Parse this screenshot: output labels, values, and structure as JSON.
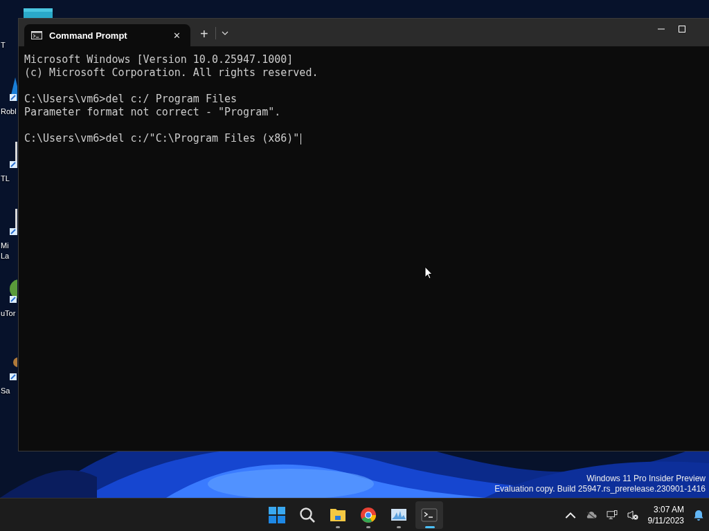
{
  "desktop": {
    "icons": [
      {
        "kind": "folder",
        "label": "T"
      },
      {
        "kind": "app",
        "label": "Robl"
      },
      {
        "kind": "doc",
        "label": "TL"
      },
      {
        "kind": "doc",
        "label": "Mi La"
      },
      {
        "kind": "torrent",
        "label": "uTor"
      },
      {
        "kind": "person",
        "label": "Sa"
      }
    ],
    "edition": [
      "Windows 11 Pro Insider Preview",
      "Evaluation copy. Build 25947.rs_prerelease.230901-1416"
    ]
  },
  "window": {
    "tabs": [
      {
        "title": "Command Prompt",
        "selected": true,
        "close": "✕"
      }
    ],
    "new_tab": "+"
  },
  "console": {
    "blocks": [
      [
        "Microsoft Windows [Version 10.0.25947.1000]",
        "(c) Microsoft Corporation. All rights reserved."
      ],
      [
        "C:\\Users\\vm6>del c:/ Program Files",
        "Parameter format not correct - \"Program\"."
      ],
      [
        "C:\\Users\\vm6>del c:/\"C:\\Program Files (x86)\""
      ]
    ],
    "cursor": true
  },
  "taskbar": {
    "apps": [
      {
        "kind": "start",
        "running": false,
        "selected": false
      },
      {
        "kind": "search",
        "running": false,
        "selected": false
      },
      {
        "kind": "files",
        "running": true,
        "selected": false
      },
      {
        "kind": "browser",
        "running": true,
        "selected": false
      },
      {
        "kind": "monitor",
        "running": true,
        "selected": false
      },
      {
        "kind": "terminal",
        "running": true,
        "selected": true
      }
    ],
    "time": "3:07 AM",
    "date": "9/11/2023"
  }
}
